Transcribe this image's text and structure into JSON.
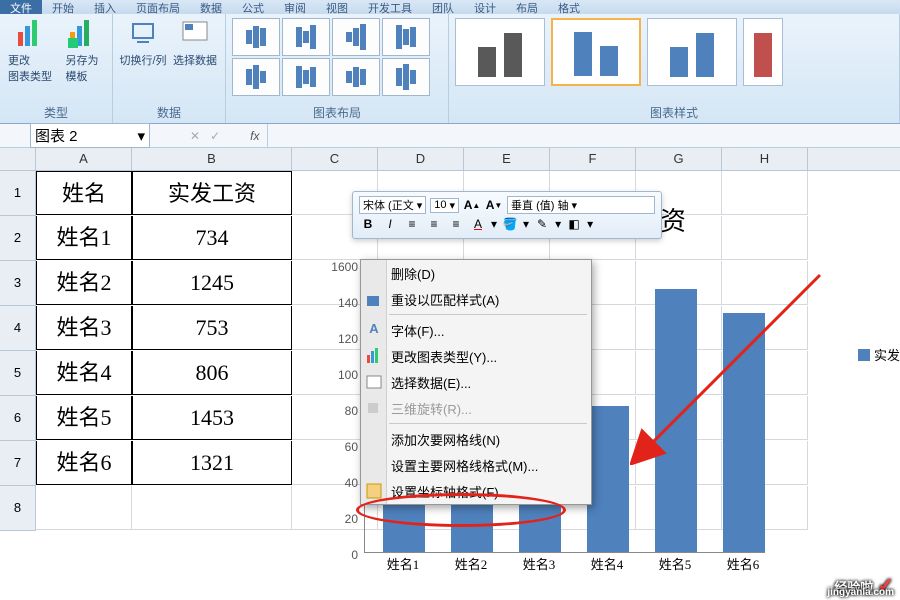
{
  "ribbon": {
    "tabs": [
      "文件",
      "开始",
      "插入",
      "页面布局",
      "数据",
      "公式",
      "审阅",
      "视图",
      "开发工具",
      "团队",
      "设计",
      "布局",
      "格式"
    ],
    "groups": {
      "type": {
        "label": "类型",
        "change_type": "更改\n图表类型",
        "save_as": "另存为\n模板"
      },
      "data": {
        "label": "数据",
        "switch": "切换行/列",
        "select": "选择数据"
      },
      "layout": {
        "label": "图表布局"
      },
      "style": {
        "label": "图表样式"
      }
    }
  },
  "namebox": {
    "value": "图表 2",
    "fx": "fx"
  },
  "columns": [
    "A",
    "B",
    "C",
    "D",
    "E",
    "F",
    "G",
    "H"
  ],
  "table": {
    "header": {
      "a": "姓名",
      "b": "实发工资"
    },
    "rows": [
      {
        "a": "姓名1",
        "b": "734"
      },
      {
        "a": "姓名2",
        "b": "1245"
      },
      {
        "a": "姓名3",
        "b": "753"
      },
      {
        "a": "姓名4",
        "b": "806"
      },
      {
        "a": "姓名5",
        "b": "1453"
      },
      {
        "a": "姓名6",
        "b": "1321"
      }
    ]
  },
  "mini_toolbar": {
    "font": "宋体 (正文",
    "size": "10",
    "axis": "垂直 (值) 轴"
  },
  "context_menu": {
    "delete": "删除(D)",
    "reset": "重设以匹配样式(A)",
    "font": "字体(F)...",
    "change_type": "更改图表类型(Y)...",
    "select_data": "选择数据(E)...",
    "rotate3d": "三维旋转(R)...",
    "minor_grid": "添加次要网格线(N)",
    "major_grid": "设置主要网格线格式(M)...",
    "axis_format": "设置坐标轴格式(F)..."
  },
  "chart_data": {
    "type": "bar",
    "title": "资",
    "categories": [
      "姓名1",
      "姓名2",
      "姓名3",
      "姓名4",
      "姓名5",
      "姓名6"
    ],
    "values": [
      734,
      1245,
      753,
      806,
      1453,
      1321
    ],
    "legend": "实发",
    "ylabel": "",
    "xlabel": "",
    "ylim": [
      0,
      1600
    ],
    "yticks": [
      1600,
      140,
      120,
      100,
      80,
      60,
      40,
      20,
      0
    ]
  },
  "watermark": {
    "brand": "经验啦",
    "site": "jingyanla.com"
  }
}
